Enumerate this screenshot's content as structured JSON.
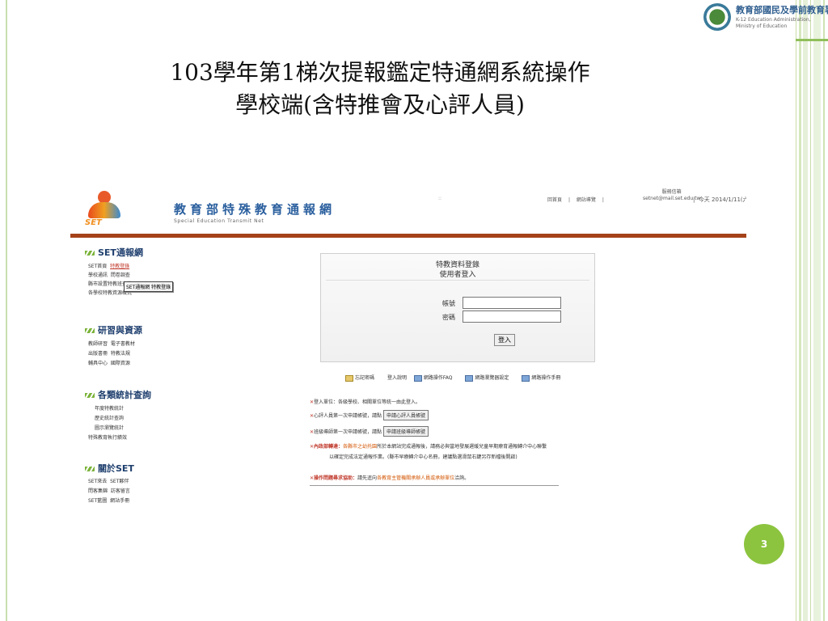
{
  "slide": {
    "title_line1": "103學年第1梯次提報鑑定特通網系統操作",
    "title_line2": "學校端(含特推會及心評人員)",
    "page_number": "3",
    "logo_title": "教育部國民及學前教育署",
    "logo_sub1": "K-12 Education Administration,",
    "logo_sub2": "Ministry of Education"
  },
  "site": {
    "logo_text": "SET",
    "title": "教育部特殊教育通報網",
    "subtitle": "Special Education Transmit Net",
    "dots": "::",
    "links": [
      "回首頁",
      "|",
      "網站導覽",
      "|"
    ],
    "service_label": "服務信箱",
    "service_email": "setnet@mail.set.edu.tw",
    "service_sep": "|",
    "today": "今天 2014/1/11(六)"
  },
  "sidebar": {
    "sec1": "SET通報網",
    "sec1_items": [
      {
        "a": "SET首頁",
        "b": "特教登錄"
      },
      {
        "a": "學校通訊",
        "b": "問卷調查"
      },
      {
        "a": "縣市設置特教班查詢",
        "b": ""
      },
      {
        "a": "各學校特教資源概況",
        "b": ""
      }
    ],
    "tooltip": "SET通報網 特教登錄",
    "sec2": "研習與資源",
    "sec2_items": [
      {
        "a": "教師研習",
        "b": "電子書教材"
      },
      {
        "a": "出版書冊",
        "b": "特教法規"
      },
      {
        "a": "輔具中心",
        "b": "國際資源"
      }
    ],
    "sec3": "各類統計查詢",
    "sec3_items": [
      "年度特教統計",
      "歷史統計查詢",
      "圖示瀏覽統計",
      "特殊教育執行績效"
    ],
    "sec4": "關於SET",
    "sec4_items": [
      {
        "a": "SET來去",
        "b": "SET夥伴"
      },
      {
        "a": "問客集錦",
        "b": "訪客留言"
      },
      {
        "a": "SET藍圖",
        "b": "網站手冊"
      }
    ]
  },
  "login": {
    "header1": "特教資料登錄",
    "header2": "使用者登入",
    "account_label": "帳號",
    "password_label": "密碼",
    "account_value": "",
    "password_value": "",
    "submit": "登入"
  },
  "help": [
    "忘記密碼",
    "登入說明",
    "網路操作FAQ",
    "網路瀏覽器設定",
    "網路操作手冊"
  ],
  "notes": {
    "n1_prefix": "登入單位：",
    "n1_text": "各級學校、相關單位等統一由此登入。",
    "n2_text": "心評人員第一次申請帳號，請點",
    "n2_button": "申請心評人員帳號",
    "n3_text": "班級導師第一次申請帳號，請點",
    "n3_button": "申請班級導師帳號",
    "n4_red": "內政部轉達：",
    "n4_org": "各縣市之幼托園",
    "n4_text": "所於本網站完成通報後，請務必與當地發展遲緩兒童早期療育通報轉介中心聯繫",
    "n4_cont": "以確定完成法定通報作業。(縣市早療轉介中心名冊，建議點選滑鼠右鍵另存新檔後開啟)",
    "n5_red": "操作問題尋求協助：",
    "n5_text": "請先逕向",
    "n5_org": "各教育主管機關承辦人員或承辦單位",
    "n5_end": "洽詢。"
  },
  "colors": {
    "accent_green": "#8cc43f",
    "site_blue": "#2a5f9e",
    "bar_brown": "#a5421a",
    "warn_red": "#c0392b"
  }
}
